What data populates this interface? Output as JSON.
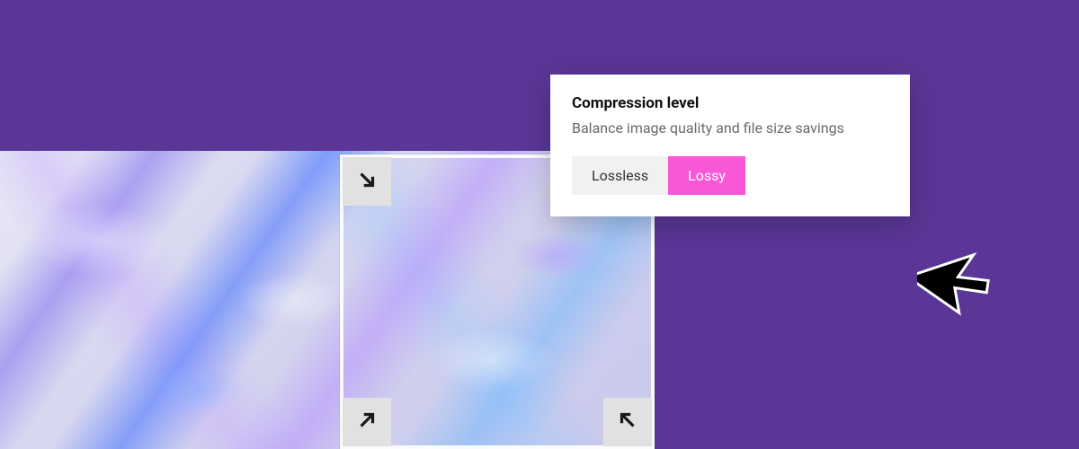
{
  "panel": {
    "title": "Compression level",
    "description": "Balance image quality and file size savings",
    "options": {
      "lossless": "Lossless",
      "lossy": "Lossy"
    },
    "selected": "lossy"
  },
  "colors": {
    "background": "#5a3696",
    "accent": "#f857d6"
  },
  "handles": {
    "tl": "arrow-down-right-icon",
    "bl": "arrow-up-right-icon",
    "br": "arrow-up-left-icon"
  }
}
